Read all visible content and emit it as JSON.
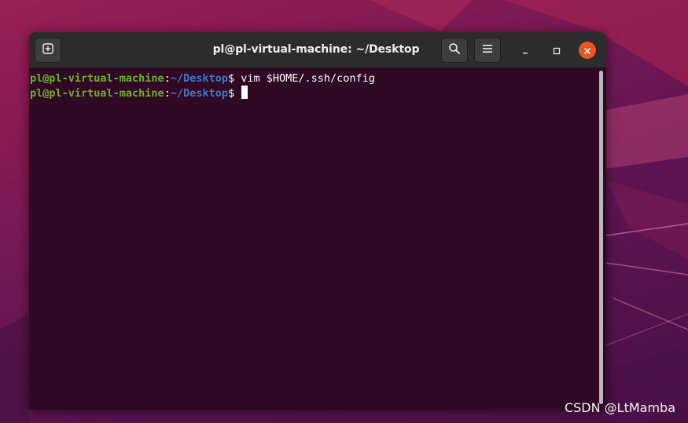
{
  "window": {
    "title": "pl@pl-virtual-machine: ~/Desktop"
  },
  "headerbar": {
    "new_tab_icon": "new-tab-icon",
    "search_icon": "search-icon",
    "menu_icon": "hamburger-menu-icon",
    "minimize_icon": "minimize-icon",
    "maximize_icon": "maximize-icon",
    "close_icon": "close-icon"
  },
  "terminal": {
    "lines": [
      {
        "user_host": "pl@pl-virtual-machine",
        "separator": ":",
        "path": "~/Desktop",
        "prompt": "$ ",
        "command": "vim $HOME/.ssh/config"
      },
      {
        "user_host": "pl@pl-virtual-machine",
        "separator": ":",
        "path": "~/Desktop",
        "prompt": "$ ",
        "command": ""
      }
    ]
  },
  "watermark": "CSDN @LtMamba",
  "colors": {
    "terminal_bg": "#300a24",
    "user_host": "#6db22c",
    "path": "#3f79c7",
    "close_button": "#e95420",
    "headerbar": "#2c2c2c"
  }
}
